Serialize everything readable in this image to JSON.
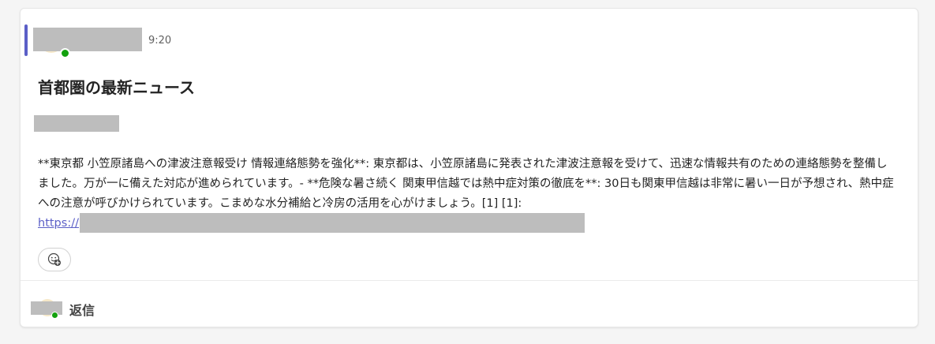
{
  "message": {
    "time": "9:20",
    "title": "首都圏の最新ニュース",
    "body": "**東京都 小笠原諸島への津波注意報受け 情報連絡態勢を強化**: 東京都は、小笠原諸島に発表された津波注意報を受けて、迅速な情報共有のための連絡態勢を整備しました。万が一に備えた対応が進められています。- **危険な暑さ続く 関東甲信越では熱中症対策の徹底を**: 30日も関東甲信越は非常に暑い一日が予想され、熱中症への注意が呼びかけられています。こまめな水分補給と冷房の活用を心がけましょう。[1] [1]:",
    "link_prefix": "https://"
  },
  "actions": {
    "reaction_icon": "add-reaction-icon",
    "reply_label": "返信"
  },
  "colors": {
    "accent": "#5b5fc7",
    "presence": "#13a10e",
    "redaction": "#bdbdbd"
  }
}
